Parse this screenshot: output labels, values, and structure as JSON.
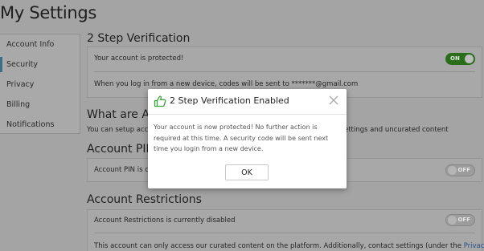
{
  "page": {
    "title": "My Settings"
  },
  "sidebar": {
    "items": [
      {
        "label": "Account Info"
      },
      {
        "label": "Security"
      },
      {
        "label": "Privacy"
      },
      {
        "label": "Billing"
      },
      {
        "label": "Notifications"
      }
    ]
  },
  "two_step": {
    "title": "2 Step Verification",
    "status": "Your account is protected!",
    "toggle": "ON",
    "info": "When you log in from a new device, codes will be sent to *******@gmail.com"
  },
  "what_are": {
    "title": "What are Acc",
    "text_left": "You can setup acco",
    "text_right": "ettings and uncurated content"
  },
  "account_pin": {
    "title": "Account PIN",
    "status": "Account PIN is cu",
    "toggle": "OFF"
  },
  "restrictions": {
    "title": "Account Restrictions",
    "status": "Account Restrictions is currently disabled",
    "toggle": "OFF",
    "info": "This account can only access our curated content on the platform. Additionally, contact settings (under the",
    "link": "Privacy"
  },
  "modal": {
    "title": "2 Step Verification Enabled",
    "body": "Your account is now protected! No further action is required at this time. A security code will be sent next time you login from a new device.",
    "ok": "OK"
  },
  "colors": {
    "toggle_on": "#2a6e1c",
    "icon_green": "#3aa63a"
  }
}
